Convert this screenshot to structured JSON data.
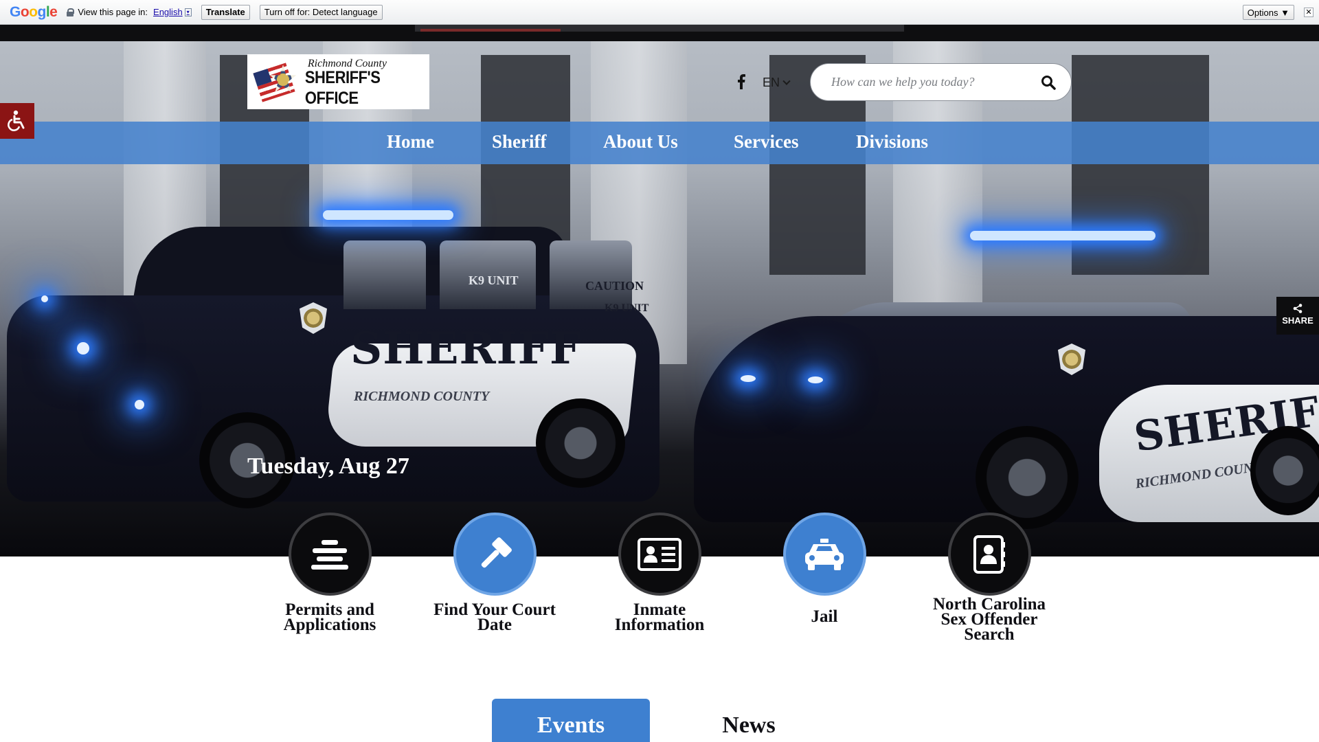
{
  "translate_bar": {
    "logo": "Google",
    "view_label": "View this page in:",
    "language": "English",
    "language_caret": "▾",
    "translate_button": "Translate",
    "turn_off_button": "Turn off for: Detect language",
    "options_button": "Options ▼",
    "close": "✕"
  },
  "header": {
    "logo_line1": "Richmond County",
    "logo_line2": "SHERIFF'S OFFICE",
    "language": "EN",
    "search_placeholder": "How can we help you today?"
  },
  "nav": {
    "items": [
      "Home",
      "Sheriff",
      "About Us",
      "Services",
      "Divisions"
    ]
  },
  "hero": {
    "date": "Tuesday, Aug 27",
    "vehicle_text": {
      "suv_sheriff": "SHERIFF",
      "suv_county": "RICHMOND COUNTY",
      "suv_k9": "K9 UNIT",
      "suv_caution": "CAUTION",
      "suv_k9_rear": "K9 UNIT",
      "car_sheriff": "SHERIFF",
      "car_county": "RICHMOND COUNTY"
    }
  },
  "share": {
    "label": "SHARE"
  },
  "quick_links": [
    {
      "label": "Permits and Applications",
      "icon": "stacked-lines-icon",
      "style": "dark"
    },
    {
      "label": "Find Your Court Date",
      "icon": "gavel-icon",
      "style": "blue"
    },
    {
      "label": "Inmate Information",
      "icon": "id-card-icon",
      "style": "dark"
    },
    {
      "label": "Jail",
      "icon": "taxi-icon",
      "style": "blue"
    },
    {
      "label": "North Carolina Sex Offender Search",
      "icon": "address-book-icon",
      "style": "dark"
    }
  ],
  "tabs": {
    "events": "Events",
    "news": "News"
  },
  "colors": {
    "nav_blue": "#4682cd",
    "accent_blue": "#3e80d0",
    "access_red": "#8b1414"
  }
}
